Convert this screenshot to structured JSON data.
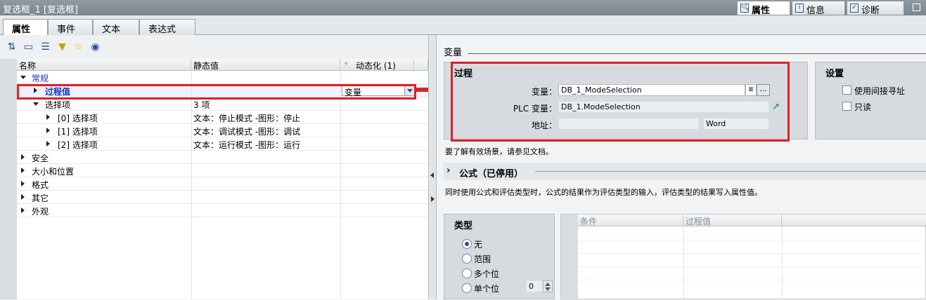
{
  "window": {
    "title": "复选框_1 [复选框]"
  },
  "inspector_tabs": [
    {
      "label": "属性",
      "icon": "properties-icon",
      "active": true
    },
    {
      "label": "信息",
      "icon": "info-icon",
      "active": false
    },
    {
      "label": "诊断",
      "icon": "diagnostics-icon",
      "active": false
    }
  ],
  "tabs": [
    "属性",
    "事件",
    "文本",
    "表达式"
  ],
  "grid": {
    "columns": [
      "名称",
      "静态值",
      "动态化 (1)"
    ],
    "rows": [
      {
        "name": "常规",
        "level": 0,
        "expanded": true,
        "static": "",
        "dynamic": "",
        "style": "blue"
      },
      {
        "name": "过程值",
        "level": 1,
        "expanded": false,
        "static": "",
        "dynamic": "变量",
        "style": "blue-bold"
      },
      {
        "name": "选择项",
        "level": 1,
        "expanded": true,
        "static": "3 项",
        "dynamic": ""
      },
      {
        "name": "[0] 选择项",
        "level": 2,
        "expanded": false,
        "static": "文本：停止模式 -图形：停止",
        "dynamic": ""
      },
      {
        "name": "[1] 选择项",
        "level": 2,
        "expanded": false,
        "static": "文本：调试模式 -图形：调试",
        "dynamic": ""
      },
      {
        "name": "[2] 选择项",
        "level": 2,
        "expanded": false,
        "static": "文本：运行模式 -图形：运行",
        "dynamic": ""
      },
      {
        "name": "安全",
        "level": 0,
        "expanded": false,
        "static": "",
        "dynamic": ""
      },
      {
        "name": "大小和位置",
        "level": 0,
        "expanded": false,
        "static": "",
        "dynamic": ""
      },
      {
        "name": "格式",
        "level": 0,
        "expanded": false,
        "static": "",
        "dynamic": ""
      },
      {
        "name": "其它",
        "level": 0,
        "expanded": false,
        "static": "",
        "dynamic": ""
      },
      {
        "name": "外观",
        "level": 0,
        "expanded": false,
        "static": "",
        "dynamic": ""
      }
    ]
  },
  "variable_section": {
    "title": "变量",
    "process": {
      "title": "过程",
      "tag_label": "变量：",
      "tag_value": "DB_1_ModeSelection",
      "plc_label": "PLC 变量：",
      "plc_value": "DB_1.ModeSelection",
      "address_label": "地址：",
      "address_value": "",
      "type_value": "Word"
    },
    "settings": {
      "title": "设置",
      "indirect_label": "使用间接寻址",
      "indirect_checked": false,
      "readonly_label": "只读",
      "readonly_checked": false
    },
    "note": "要了解有效场景，请参见文档。"
  },
  "formula": {
    "title": "公式（已停用）",
    "desc": "同时使用公式和评估类型时，公式的结果作为评估类型的输入，评估类型的结果写入属性值。"
  },
  "type_box": {
    "title": "类型",
    "options": [
      {
        "label": "无",
        "selected": true
      },
      {
        "label": "范围",
        "selected": false
      },
      {
        "label": "多个位",
        "selected": false
      },
      {
        "label": "单个位",
        "selected": false
      }
    ],
    "bit_value": "0"
  },
  "condition_table": {
    "columns": [
      "条件",
      "过程值"
    ]
  },
  "colors": {
    "highlight": "#e01f26",
    "link": "#1232c8",
    "accent": "#1f4f9f"
  }
}
